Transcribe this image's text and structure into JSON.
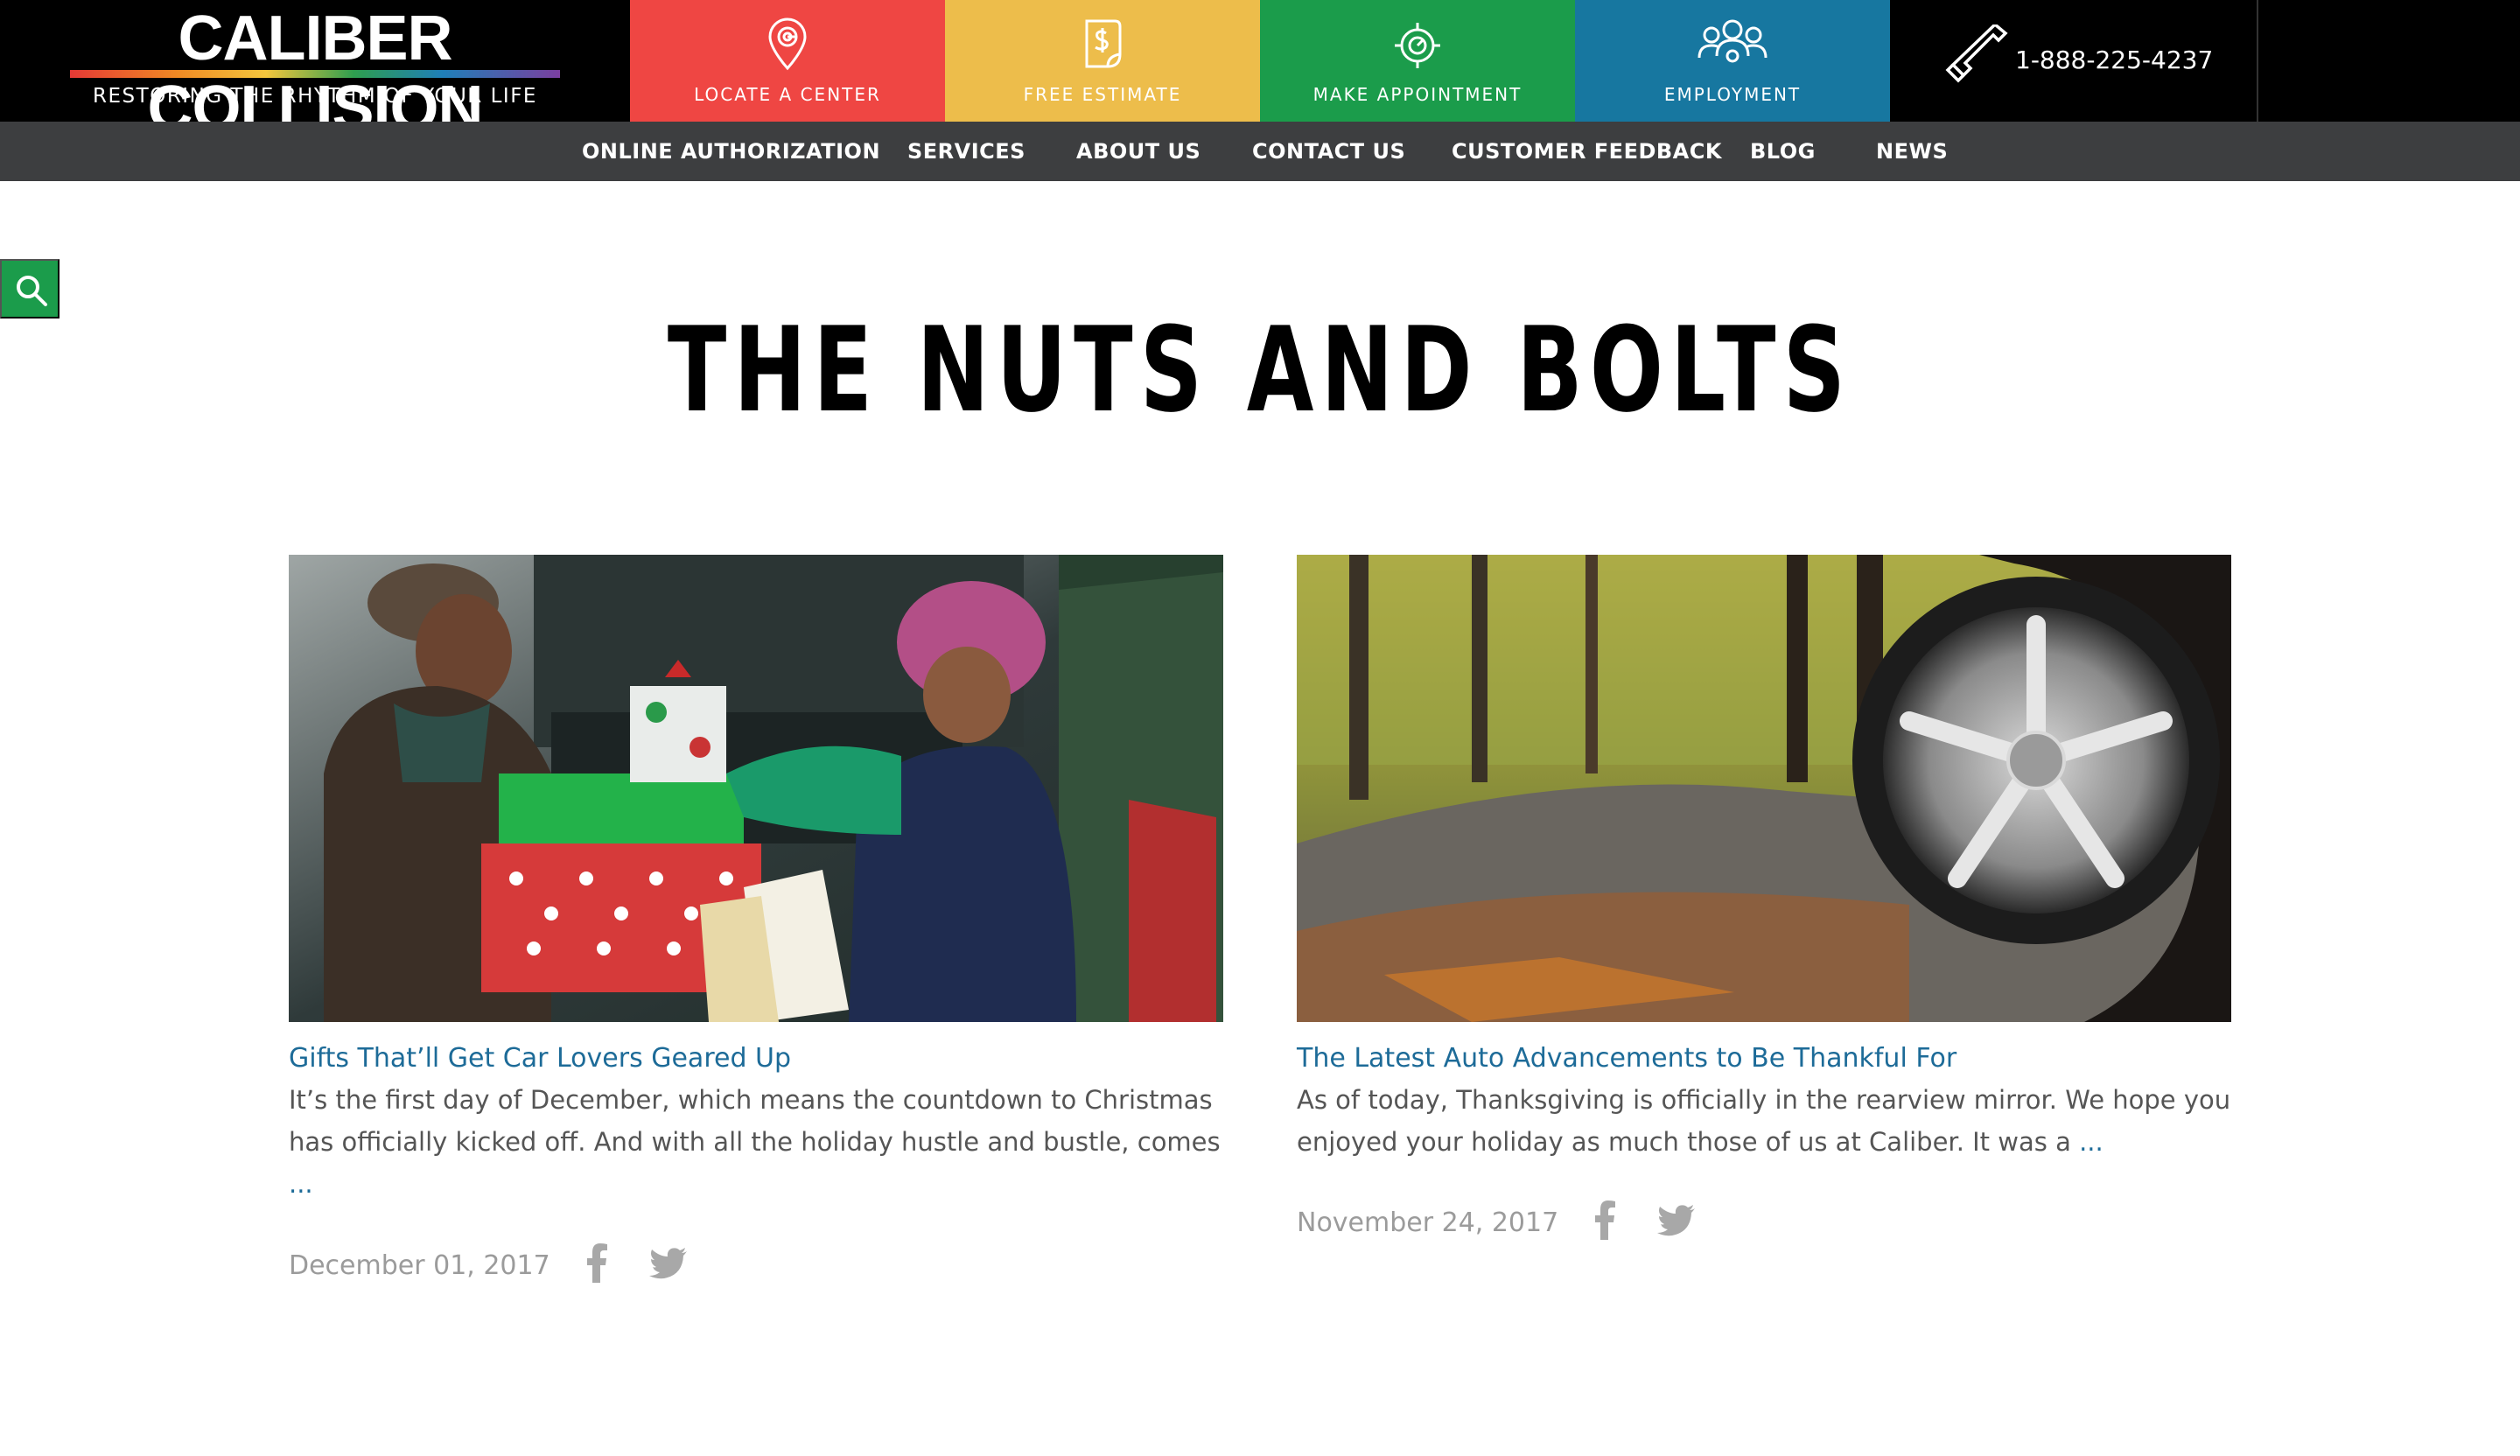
{
  "header": {
    "logo_title": "CALIBER COLLISION",
    "logo_tagline": "RESTORING THE RHYTHM OF YOUR LIFE",
    "tiles": [
      {
        "label": "LOCATE A CENTER",
        "icon": "location-pin-icon",
        "color": "#ef4643"
      },
      {
        "label": "FREE ESTIMATE",
        "icon": "estimate-document-icon",
        "color": "#edbd4b"
      },
      {
        "label": "MAKE APPOINTMENT",
        "icon": "appointment-target-icon",
        "color": "#1b9c4b"
      },
      {
        "label": "EMPLOYMENT",
        "icon": "people-group-icon",
        "color": "#1777a0"
      }
    ],
    "phone": "1-888-225-4237",
    "phone_icon": "phone-icon"
  },
  "nav": {
    "items": [
      "ONLINE AUTHORIZATION",
      "SERVICES",
      "ABOUT US",
      "CONTACT US",
      "CUSTOMER FEEDBACK",
      "BLOG",
      "NEWS"
    ]
  },
  "search": {
    "icon": "search-icon",
    "color": "#1b9c4b"
  },
  "page": {
    "title": "THE NUTS AND BOLTS"
  },
  "posts": [
    {
      "image": "holiday-gift-exchange-photo",
      "title": "Gifts That’ll Get Car Lovers Geared Up",
      "excerpt_line1": "It’s the first day of December, which means the countdown to Christmas",
      "excerpt_line2": "has officially kicked off. And with all the holiday hustle and bustle, comes",
      "more": "...",
      "date": "December 01, 2017",
      "share_icons": [
        "facebook-icon",
        "twitter-icon"
      ]
    },
    {
      "image": "autumn-road-wheel-photo",
      "title": "The Latest Auto Advancements to Be Thankful For",
      "excerpt_line1": "As of today, Thanksgiving is officially in the rearview mirror. We hope you",
      "excerpt_line2": "enjoyed your holiday as much those of us at Caliber. It was a",
      "more": "...",
      "date": "November 24, 2017",
      "share_icons": [
        "facebook-icon",
        "twitter-icon"
      ]
    }
  ]
}
